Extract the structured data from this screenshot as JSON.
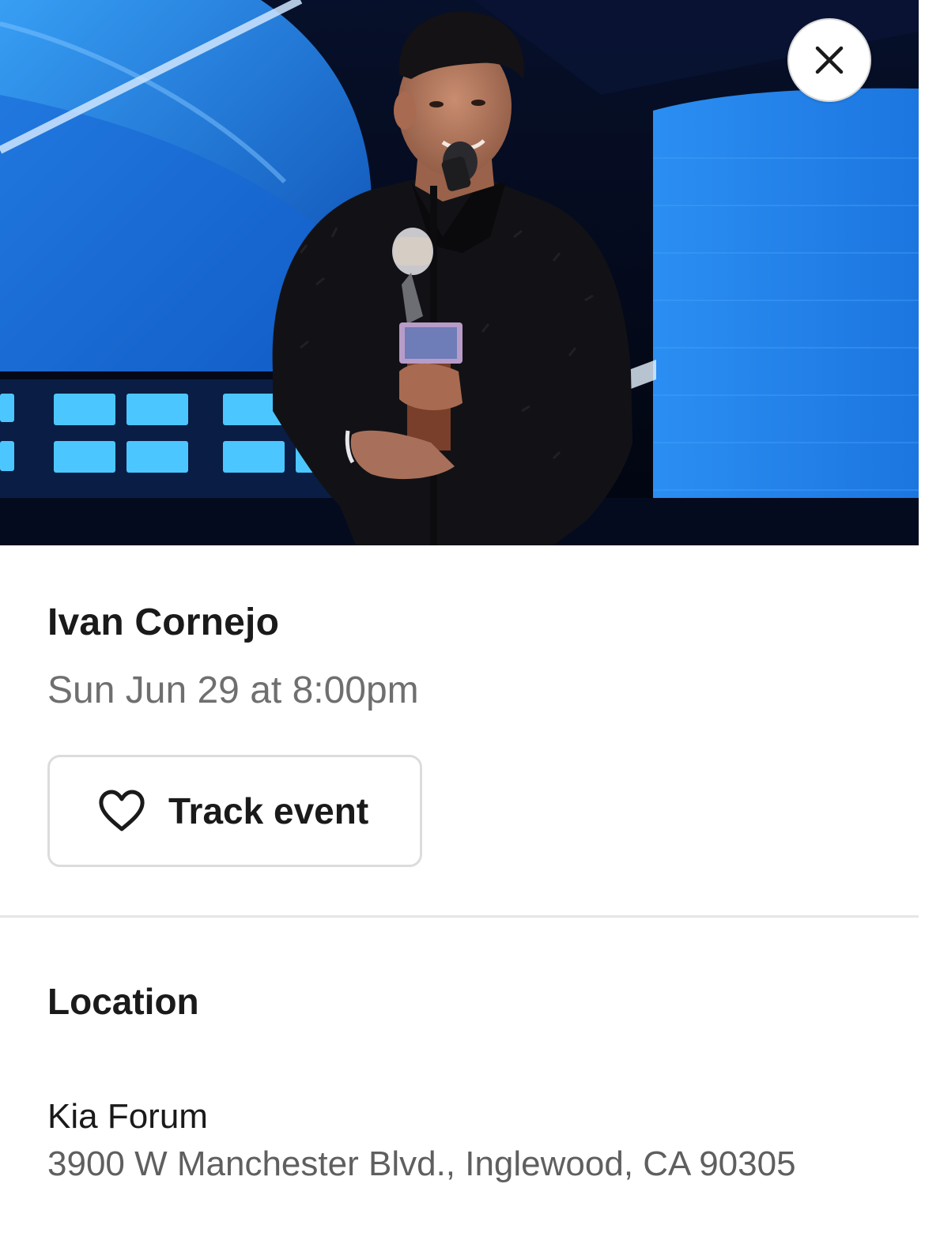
{
  "hero": {
    "image_alt": "Performer holding an award at a microphone on stage"
  },
  "close_button": {
    "icon": "close-icon"
  },
  "event": {
    "title": "Ivan Cornejo",
    "datetime": "Sun Jun 29 at 8:00pm"
  },
  "track_button": {
    "icon": "heart-outline-icon",
    "label": "Track event"
  },
  "location": {
    "section_title": "Location",
    "venue_name": "Kia Forum",
    "address": "3900 W Manchester Blvd., Inglewood, CA 90305"
  },
  "colors": {
    "stage_blue": "#1f8ff0",
    "stage_dark": "#050a1c",
    "muted_text": "#6f6f6f",
    "border": "#dcdcdc"
  }
}
